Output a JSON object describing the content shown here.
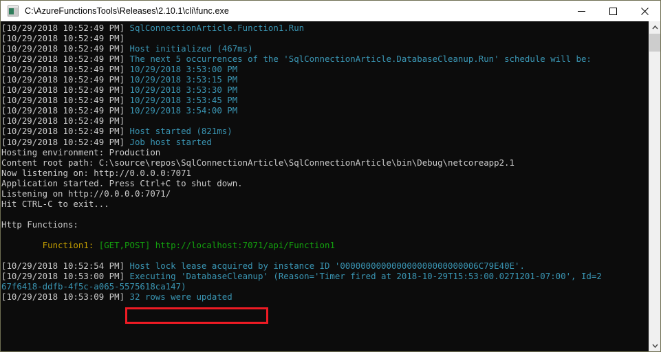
{
  "window": {
    "title": "C:\\AzureFunctionsTools\\Releases\\2.10.1\\cli\\func.exe",
    "icon": "console-app-icon",
    "controls": {
      "minimize_label": "Minimize",
      "maximize_label": "Maximize",
      "close_label": "Close"
    }
  },
  "console": {
    "background_color": "#0c0c0c",
    "colors": {
      "gray": "#cccccc",
      "teal": "#3a96b4",
      "green": "#13a10e",
      "yellow": "#c19c00"
    },
    "lines": [
      {
        "id": 0,
        "segments": [
          {
            "text": "[10/29/2018 10:52:49 PM] ",
            "color": "gray"
          },
          {
            "text": "SqlConnectionArticle.Function1.Run",
            "color": "teal"
          }
        ]
      },
      {
        "id": 1,
        "segments": [
          {
            "text": "[10/29/2018 10:52:49 PM] ",
            "color": "gray"
          }
        ]
      },
      {
        "id": 2,
        "segments": [
          {
            "text": "[10/29/2018 10:52:49 PM] ",
            "color": "gray"
          },
          {
            "text": "Host initialized (467ms)",
            "color": "teal"
          }
        ]
      },
      {
        "id": 3,
        "segments": [
          {
            "text": "[10/29/2018 10:52:49 PM] ",
            "color": "gray"
          },
          {
            "text": "The next 5 occurrences of the 'SqlConnectionArticle.DatabaseCleanup.Run' schedule will be:",
            "color": "teal"
          }
        ]
      },
      {
        "id": 4,
        "segments": [
          {
            "text": "[10/29/2018 10:52:49 PM] ",
            "color": "gray"
          },
          {
            "text": "10/29/2018 3:53:00 PM",
            "color": "teal"
          }
        ]
      },
      {
        "id": 5,
        "segments": [
          {
            "text": "[10/29/2018 10:52:49 PM] ",
            "color": "gray"
          },
          {
            "text": "10/29/2018 3:53:15 PM",
            "color": "teal"
          }
        ]
      },
      {
        "id": 6,
        "segments": [
          {
            "text": "[10/29/2018 10:52:49 PM] ",
            "color": "gray"
          },
          {
            "text": "10/29/2018 3:53:30 PM",
            "color": "teal"
          }
        ]
      },
      {
        "id": 7,
        "segments": [
          {
            "text": "[10/29/2018 10:52:49 PM] ",
            "color": "gray"
          },
          {
            "text": "10/29/2018 3:53:45 PM",
            "color": "teal"
          }
        ]
      },
      {
        "id": 8,
        "segments": [
          {
            "text": "[10/29/2018 10:52:49 PM] ",
            "color": "gray"
          },
          {
            "text": "10/29/2018 3:54:00 PM",
            "color": "teal"
          }
        ]
      },
      {
        "id": 9,
        "segments": [
          {
            "text": "[10/29/2018 10:52:49 PM] ",
            "color": "gray"
          }
        ]
      },
      {
        "id": 10,
        "segments": [
          {
            "text": "[10/29/2018 10:52:49 PM] ",
            "color": "gray"
          },
          {
            "text": "Host started (821ms)",
            "color": "teal"
          }
        ]
      },
      {
        "id": 11,
        "segments": [
          {
            "text": "[10/29/2018 10:52:49 PM] ",
            "color": "gray"
          },
          {
            "text": "Job host started",
            "color": "teal"
          }
        ]
      },
      {
        "id": 12,
        "segments": [
          {
            "text": "Hosting environment: Production",
            "color": "gray"
          }
        ]
      },
      {
        "id": 13,
        "segments": [
          {
            "text": "Content root path: C:\\source\\repos\\SqlConnectionArticle\\SqlConnectionArticle\\bin\\Debug\\netcoreapp2.1",
            "color": "gray"
          }
        ]
      },
      {
        "id": 14,
        "segments": [
          {
            "text": "Now listening on: http://0.0.0.0:7071",
            "color": "gray"
          }
        ]
      },
      {
        "id": 15,
        "segments": [
          {
            "text": "Application started. Press Ctrl+C to shut down.",
            "color": "gray"
          }
        ]
      },
      {
        "id": 16,
        "segments": [
          {
            "text": "Listening on http://0.0.0.0:7071/",
            "color": "gray"
          }
        ]
      },
      {
        "id": 17,
        "segments": [
          {
            "text": "Hit CTRL-C to exit...",
            "color": "gray"
          }
        ]
      },
      {
        "id": 18,
        "segments": [
          {
            "text": "",
            "color": "gray"
          }
        ]
      },
      {
        "id": 19,
        "segments": [
          {
            "text": "Http Functions:",
            "color": "gray"
          }
        ]
      },
      {
        "id": 20,
        "segments": [
          {
            "text": "",
            "color": "gray"
          }
        ]
      },
      {
        "id": 21,
        "segments": [
          {
            "text": "        Function1: ",
            "color": "yellow"
          },
          {
            "text": "[GET,POST] http://localhost:7071/api/Function1",
            "color": "green"
          }
        ]
      },
      {
        "id": 22,
        "segments": [
          {
            "text": "",
            "color": "gray"
          }
        ]
      },
      {
        "id": 23,
        "segments": [
          {
            "text": "[10/29/2018 10:52:54 PM] ",
            "color": "gray"
          },
          {
            "text": "Host lock lease acquired by instance ID '000000000000000000000000006C79E40E'.",
            "color": "teal"
          }
        ]
      },
      {
        "id": 24,
        "segments": [
          {
            "text": "[10/29/2018 10:53:00 PM] ",
            "color": "gray"
          },
          {
            "text": "Executing 'DatabaseCleanup' (Reason='Timer fired at 2018-10-29T15:53:00.0271201-07:00', Id=2",
            "color": "teal"
          }
        ]
      },
      {
        "id": 25,
        "segments": [
          {
            "text": "67f6418-ddfb-4f5c-a065-5575618ca147)",
            "color": "teal"
          }
        ]
      },
      {
        "id": 26,
        "segments": [
          {
            "text": "[10/29/2018 10:53:09 PM] ",
            "color": "gray"
          },
          {
            "text": "32 rows were updated",
            "color": "teal"
          }
        ]
      }
    ]
  },
  "annotation": {
    "highlight_color": "#ee1b24",
    "highlighted_text": "] 32 rows were updated"
  },
  "scrollbar": {
    "up_arrow": "chevron-up-icon",
    "down_arrow": "chevron-down-icon",
    "thumb_label": "scrollbar-thumb"
  }
}
